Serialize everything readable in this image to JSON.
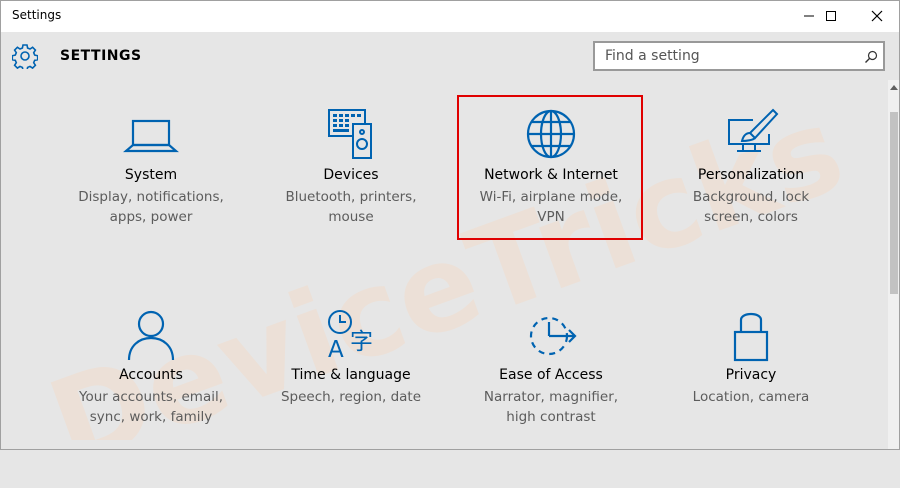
{
  "window": {
    "title": "Settings",
    "controls": [
      "minimize",
      "maximize",
      "close"
    ]
  },
  "header": {
    "title": "SETTINGS",
    "search_placeholder": "Find a setting"
  },
  "tiles": [
    {
      "name": "System",
      "desc": "Display, notifications, apps, power",
      "icon": "laptop-icon"
    },
    {
      "name": "Devices",
      "desc": "Bluetooth, printers, mouse",
      "icon": "devices-icon"
    },
    {
      "name": "Network & Internet",
      "desc": "Wi-Fi, airplane mode, VPN",
      "icon": "globe-icon"
    },
    {
      "name": "Personalization",
      "desc": "Background, lock screen, colors",
      "icon": "paint-brush-icon"
    },
    {
      "name": "Accounts",
      "desc": "Your accounts, email, sync, work, family",
      "icon": "person-icon"
    },
    {
      "name": "Time & language",
      "desc": "Speech, region, date",
      "icon": "clock-language-icon"
    },
    {
      "name": "Ease of Access",
      "desc": "Narrator, magnifier, high contrast",
      "icon": "ease-of-access-icon"
    },
    {
      "name": "Privacy",
      "desc": "Location, camera",
      "icon": "lock-icon"
    }
  ],
  "watermark": "DeviceTricks",
  "colors": {
    "accent": "#0063b1",
    "highlight": "#e00000",
    "watermark": "#f0d9c6",
    "background": "#e6e6e6"
  }
}
